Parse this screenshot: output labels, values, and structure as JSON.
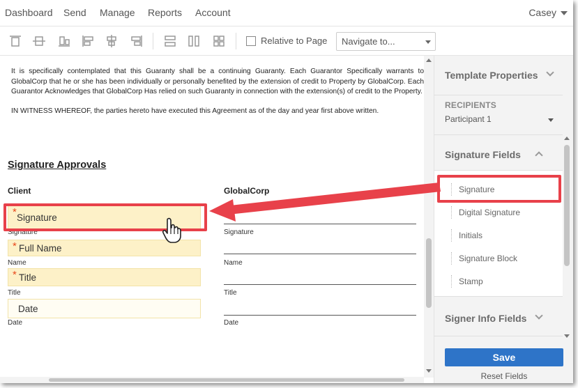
{
  "nav": {
    "items": [
      "Dashboard",
      "Send",
      "Manage",
      "Reports",
      "Account"
    ],
    "user": "Casey"
  },
  "toolbar": {
    "icons": [
      "align-top-icon",
      "align-middle-icon",
      "align-bottom-icon",
      "align-left-icon",
      "align-center-icon",
      "align-right-icon",
      "match-width-icon",
      "match-height-icon",
      "match-size-icon"
    ],
    "relative_label": "Relative to Page",
    "relative_checked": false,
    "navigate_placeholder": "Navigate to..."
  },
  "document": {
    "paragraph1": "It is specifically contemplated that this Guaranty shall be a continuing Guaranty. Each Guarantor Specifically warrants to GlobalCorp that he or she has been individually or personally benefited by the extension of credit to Property by GlobalCorp. Each Guarantor Acknowledges that GlobalCorp Has relied on such Guaranty in connection with the extension(s) of credit to the Property.",
    "paragraph2": "IN WITNESS WHEREOF, the parties hereto have executed this Agreement as of the day and year first above written.",
    "section_title": "Signature Approvals",
    "client_heading": "Client",
    "globalcorp_heading": "GlobalCorp",
    "client_fields": [
      {
        "label": "Signature",
        "required": true,
        "sub": "Signature"
      },
      {
        "label": "Full Name",
        "required": true,
        "sub": "Name"
      },
      {
        "label": "Title",
        "required": true,
        "sub": "Title"
      },
      {
        "label": "Date",
        "required": false,
        "sub": "Date"
      }
    ],
    "globalcorp_lines": [
      "Signature",
      "Name",
      "Title",
      "Date"
    ],
    "required_mark": "*"
  },
  "panel": {
    "template_properties": "Template Properties",
    "recipients_heading": "RECIPIENTS",
    "recipient_selected": "Participant 1",
    "signature_fields_heading": "Signature Fields",
    "signature_fields": [
      "Signature",
      "Digital Signature",
      "Initials",
      "Signature Block",
      "Stamp"
    ],
    "signer_info_heading": "Signer Info Fields",
    "save_label": "Save",
    "reset_label": "Reset Fields"
  },
  "colors": {
    "accent": "#2e74c8",
    "highlight": "#e8414a",
    "field_bg": "#fdf1c8",
    "required": "#e8491c"
  }
}
